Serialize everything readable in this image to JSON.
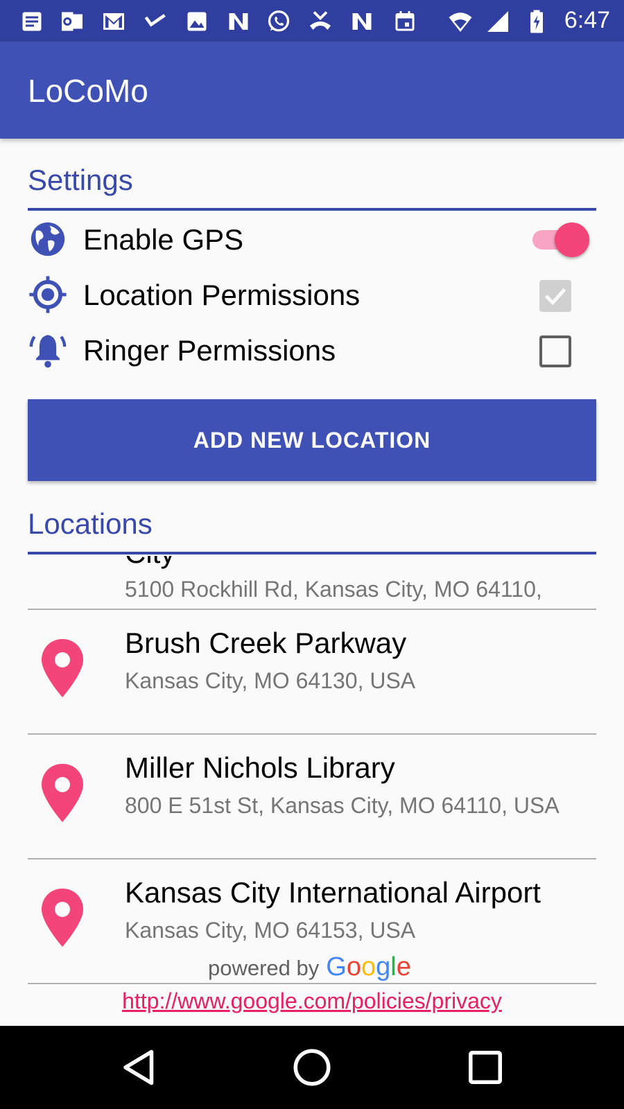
{
  "status_bar": {
    "time": "6:47",
    "icons": [
      "notes-icon",
      "outlook-icon",
      "gmail-icon",
      "check-icon",
      "image-icon",
      "n-icon",
      "whatsapp-icon",
      "missed-call-icon",
      "n-icon",
      "calendar-icon",
      "wifi-icon",
      "signal-icon",
      "battery-charging-icon"
    ]
  },
  "app_bar": {
    "title": "LoCoMo"
  },
  "settings": {
    "header": "Settings",
    "items": [
      {
        "label": "Enable GPS",
        "icon": "globe-icon",
        "control": "toggle",
        "state": "on"
      },
      {
        "label": "Location Permissions",
        "icon": "crosshair-location-icon",
        "control": "checkbox",
        "state": "checked-disabled"
      },
      {
        "label": "Ringer Permissions",
        "icon": "ringing-bell-icon",
        "control": "checkbox",
        "state": "unchecked"
      }
    ]
  },
  "add_button": {
    "label": "ADD NEW LOCATION"
  },
  "locations": {
    "header": "Locations",
    "partial_item": {
      "name": "City",
      "address": "5100 Rockhill Rd, Kansas City, MO 64110,"
    },
    "items": [
      {
        "name": "Brush Creek Parkway",
        "address": "Kansas City, MO 64130, USA"
      },
      {
        "name": "Miller Nichols Library",
        "address": "800 E 51st St, Kansas City, MO 64110, USA"
      },
      {
        "name": "Kansas City International Airport",
        "address": "Kansas City, MO 64153, USA"
      }
    ]
  },
  "attribution": {
    "powered_by": "powered by",
    "google_letters": [
      "G",
      "o",
      "o",
      "g",
      "l",
      "e"
    ],
    "privacy_link": "http://www.google.com/policies/privacy"
  },
  "colors": {
    "primary": "#3f51b5",
    "primary_dark": "#303f9f",
    "accent": "#f4457a",
    "link": "#e91e63"
  },
  "nav_bar": {
    "buttons": [
      "back-icon",
      "home-icon",
      "recents-icon"
    ]
  }
}
